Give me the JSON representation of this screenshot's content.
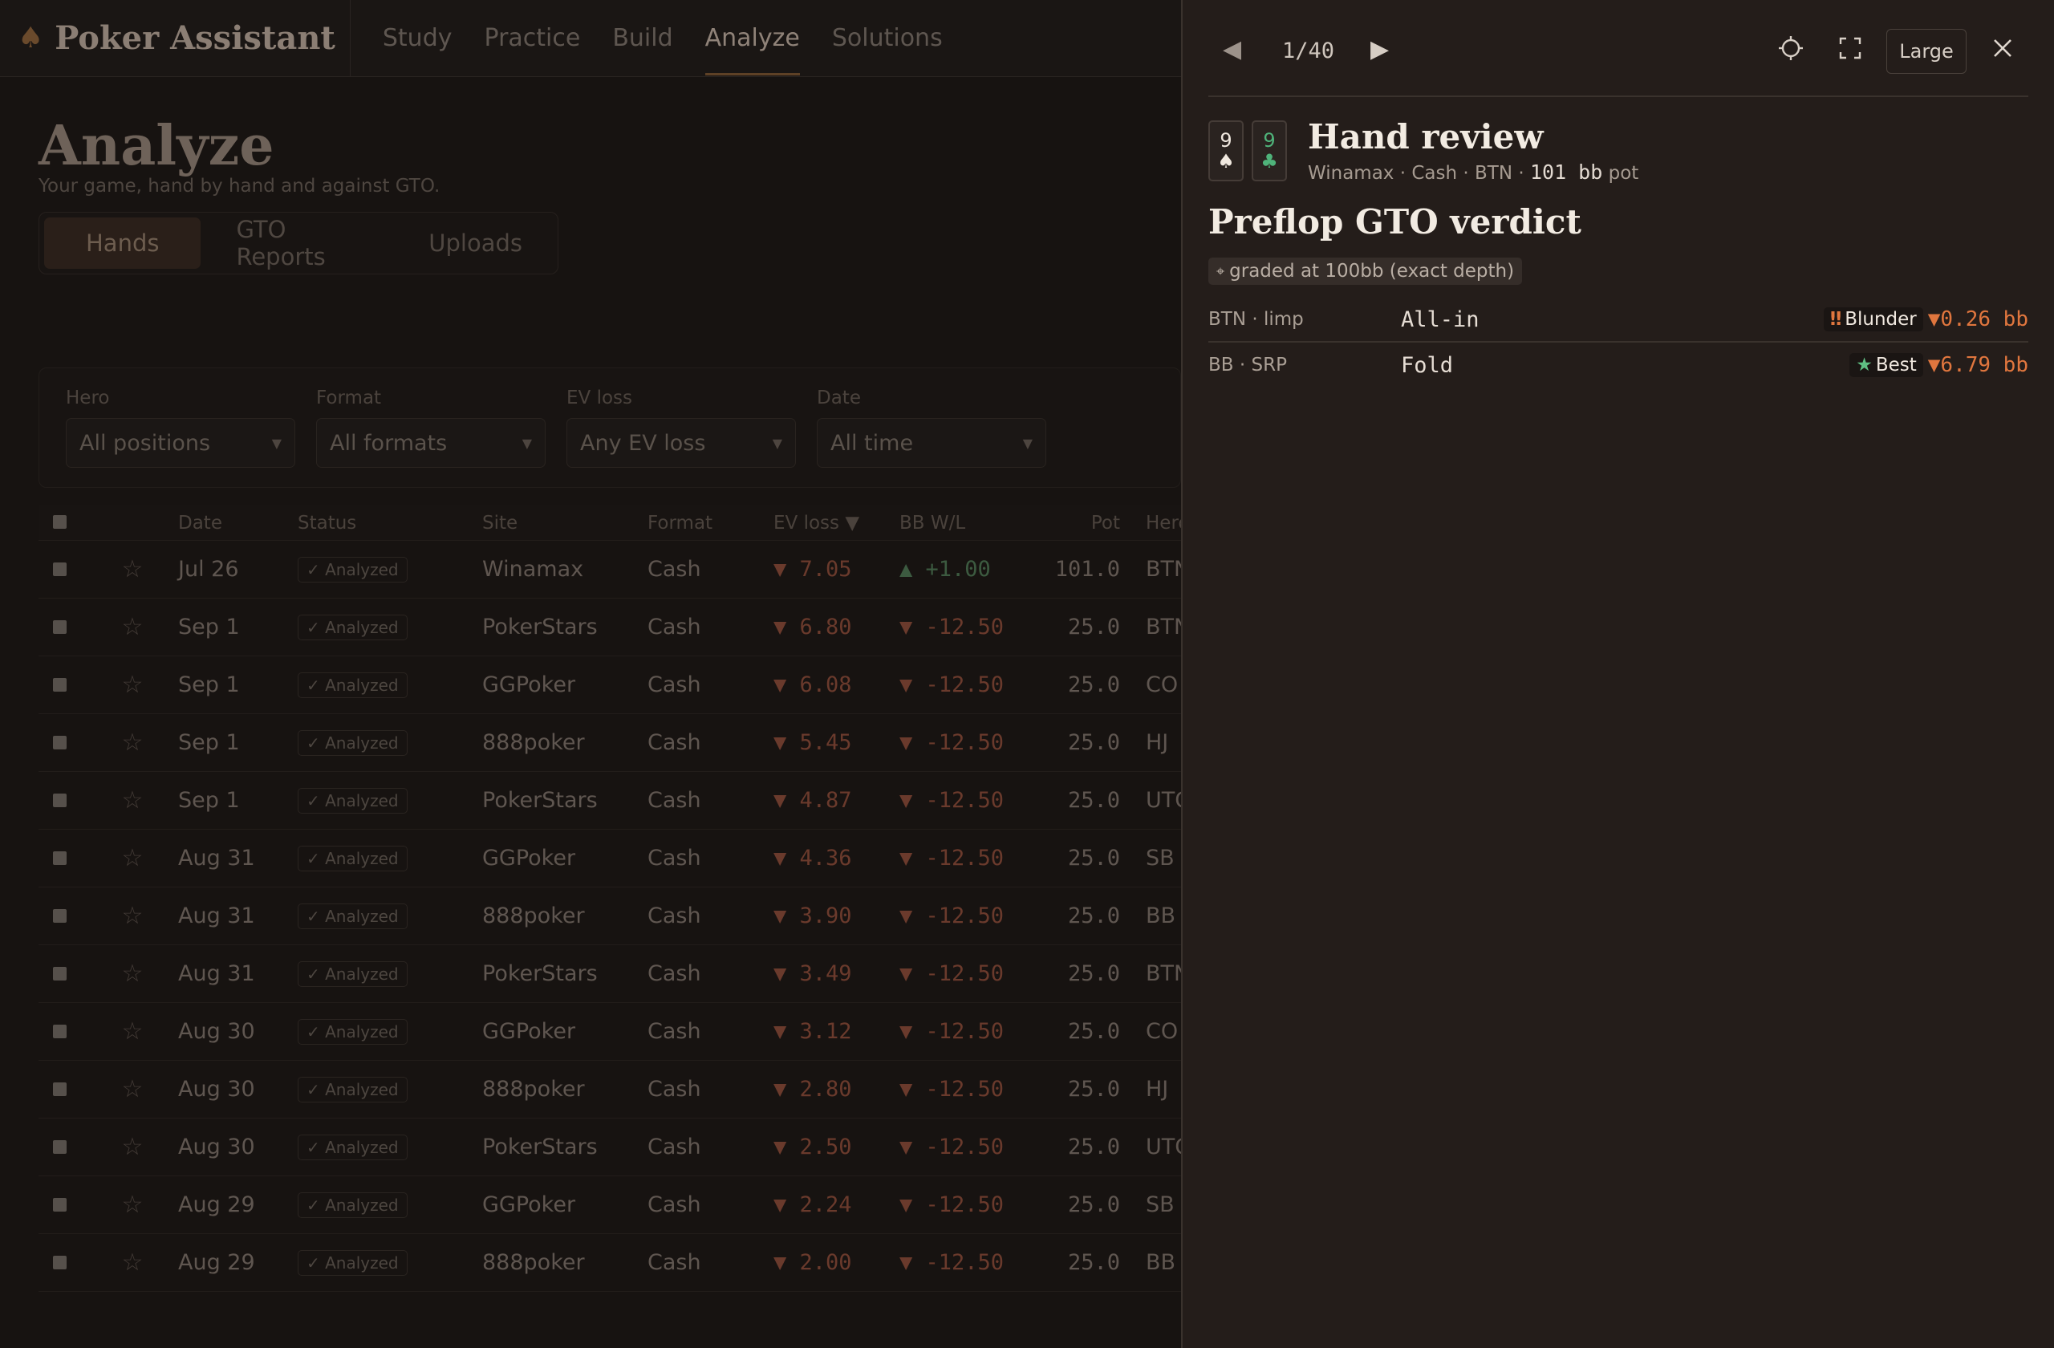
{
  "app": {
    "title": "Poker Assistant",
    "logo_icon": "spade-icon"
  },
  "nav": [
    {
      "label": "Study"
    },
    {
      "label": "Practice"
    },
    {
      "label": "Build"
    },
    {
      "label": "Analyze",
      "active": true
    },
    {
      "label": "Solutions"
    }
  ],
  "page": {
    "title": "Analyze",
    "subtitle": "Your game, hand by hand and against GTO.",
    "tabs": [
      {
        "label": "Hands",
        "active": true
      },
      {
        "label": "GTO Reports"
      },
      {
        "label": "Uploads"
      }
    ]
  },
  "filters": [
    {
      "label": "Hero",
      "value": "All positions"
    },
    {
      "label": "Format",
      "value": "All formats"
    },
    {
      "label": "EV loss",
      "value": "Any EV loss"
    },
    {
      "label": "Date",
      "value": "All time"
    }
  ],
  "table": {
    "columns": [
      "Date",
      "Status",
      "Site",
      "Format",
      "EV loss ▼",
      "BB W/L",
      "Pot",
      "Hero"
    ],
    "rows": [
      {
        "date": "Jul 26",
        "status": "✓ Analyzed",
        "site": "Winamax",
        "format": "Cash",
        "ev": "▼ 7.05",
        "bb": "▲ +1.00",
        "bb_pos": true,
        "pot": "101.0",
        "hero": "BTN"
      },
      {
        "date": "Sep 1",
        "status": "✓ Analyzed",
        "site": "PokerStars",
        "format": "Cash",
        "ev": "▼ 6.80",
        "bb": "▼ -12.50",
        "pot": "25.0",
        "hero": "BTN"
      },
      {
        "date": "Sep 1",
        "status": "✓ Analyzed",
        "site": "GGPoker",
        "format": "Cash",
        "ev": "▼ 6.08",
        "bb": "▼ -12.50",
        "pot": "25.0",
        "hero": "CO"
      },
      {
        "date": "Sep 1",
        "status": "✓ Analyzed",
        "site": "888poker",
        "format": "Cash",
        "ev": "▼ 5.45",
        "bb": "▼ -12.50",
        "pot": "25.0",
        "hero": "HJ"
      },
      {
        "date": "Sep 1",
        "status": "✓ Analyzed",
        "site": "PokerStars",
        "format": "Cash",
        "ev": "▼ 4.87",
        "bb": "▼ -12.50",
        "pot": "25.0",
        "hero": "UTG"
      },
      {
        "date": "Aug 31",
        "status": "✓ Analyzed",
        "site": "GGPoker",
        "format": "Cash",
        "ev": "▼ 4.36",
        "bb": "▼ -12.50",
        "pot": "25.0",
        "hero": "SB"
      },
      {
        "date": "Aug 31",
        "status": "✓ Analyzed",
        "site": "888poker",
        "format": "Cash",
        "ev": "▼ 3.90",
        "bb": "▼ -12.50",
        "pot": "25.0",
        "hero": "BB"
      },
      {
        "date": "Aug 31",
        "status": "✓ Analyzed",
        "site": "PokerStars",
        "format": "Cash",
        "ev": "▼ 3.49",
        "bb": "▼ -12.50",
        "pot": "25.0",
        "hero": "BTN"
      },
      {
        "date": "Aug 30",
        "status": "✓ Analyzed",
        "site": "GGPoker",
        "format": "Cash",
        "ev": "▼ 3.12",
        "bb": "▼ -12.50",
        "pot": "25.0",
        "hero": "CO"
      },
      {
        "date": "Aug 30",
        "status": "✓ Analyzed",
        "site": "888poker",
        "format": "Cash",
        "ev": "▼ 2.80",
        "bb": "▼ -12.50",
        "pot": "25.0",
        "hero": "HJ"
      },
      {
        "date": "Aug 30",
        "status": "✓ Analyzed",
        "site": "PokerStars",
        "format": "Cash",
        "ev": "▼ 2.50",
        "bb": "▼ -12.50",
        "pot": "25.0",
        "hero": "UTG"
      },
      {
        "date": "Aug 29",
        "status": "✓ Analyzed",
        "site": "GGPoker",
        "format": "Cash",
        "ev": "▼ 2.24",
        "bb": "▼ -12.50",
        "pot": "25.0",
        "hero": "SB"
      },
      {
        "date": "Aug 29",
        "status": "✓ Analyzed",
        "site": "888poker",
        "format": "Cash",
        "ev": "▼ 2.00",
        "bb": "▼ -12.50",
        "pot": "25.0",
        "hero": "BB"
      }
    ]
  },
  "drawer": {
    "pager": {
      "text": "1/40",
      "prev_icon": "◀",
      "next_icon": "▶"
    },
    "size_label": "Large",
    "cards": [
      {
        "rank": "9",
        "suit": "♠",
        "color": "#f0e8df"
      },
      {
        "rank": "9",
        "suit": "♣",
        "color": "#4fb37a"
      }
    ],
    "hand_title": "Hand review",
    "hand_meta": {
      "prefix": "Winamax · Cash · BTN · ",
      "pot": "101 bb",
      "suffix": " pot"
    },
    "verdict_title": "Preflop GTO verdict",
    "grade_chip": {
      "icon": "⌖",
      "text": "graded at 100bb (exact depth)"
    },
    "rows": [
      {
        "position": "BTN · limp",
        "action": "All-in",
        "badge_icon": "‼",
        "badge_icon_color": "#e0763e",
        "badge_label": "Blunder",
        "ev": "▼0.26 bb"
      },
      {
        "position": "BB · SRP",
        "action": "Fold",
        "badge_icon": "★",
        "badge_icon_color": "#5fbf83",
        "badge_label": "Best",
        "ev": "▼6.79 bb"
      }
    ]
  },
  "colors": {
    "accent": "#e0763e",
    "positive": "#4fb37a",
    "drawer_bg": "#241d1a",
    "page_bg": "#171311"
  }
}
